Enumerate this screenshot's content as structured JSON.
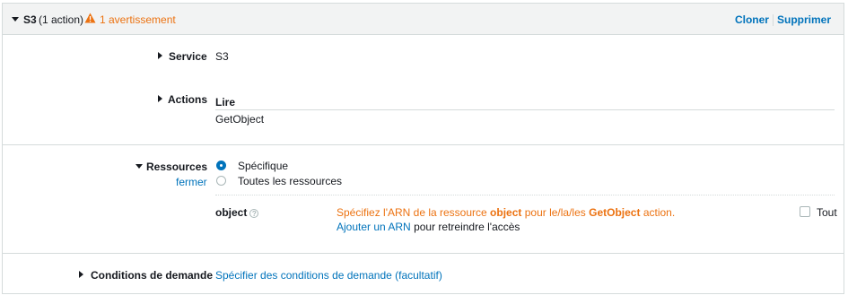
{
  "header": {
    "title": "S3",
    "action_count": "(1 action)",
    "warning_text": "1 avertissement",
    "clone_label": "Cloner",
    "delete_label": "Supprimer"
  },
  "service": {
    "label": "Service",
    "value": "S3"
  },
  "actions": {
    "label": "Actions",
    "group": "Lire",
    "item": "GetObject"
  },
  "resources": {
    "label": "Ressources",
    "close_label": "fermer",
    "options": [
      "Spécifique",
      "Toutes les ressources"
    ],
    "selected": "Spécifique",
    "row": {
      "name": "object",
      "help_glyph": "?",
      "msg_prefix": "Spécifiez l'ARN de la ressource",
      "msg_resource": "object",
      "msg_middle": "pour le/la/les",
      "msg_action": "GetObject",
      "msg_suffix": "action.",
      "add_arn_label": "Ajouter un ARN",
      "add_arn_suffix": "pour retreindre l'accès",
      "all_label": "Tout",
      "all_checked": false
    }
  },
  "conditions": {
    "label": "Conditions de demande",
    "link": "Spécifier des conditions de demande (facultatif)"
  },
  "colors": {
    "link": "#0073bb",
    "warning": "#ec7211",
    "header_bg": "#f2f3f3",
    "border": "#d5dbdb"
  }
}
